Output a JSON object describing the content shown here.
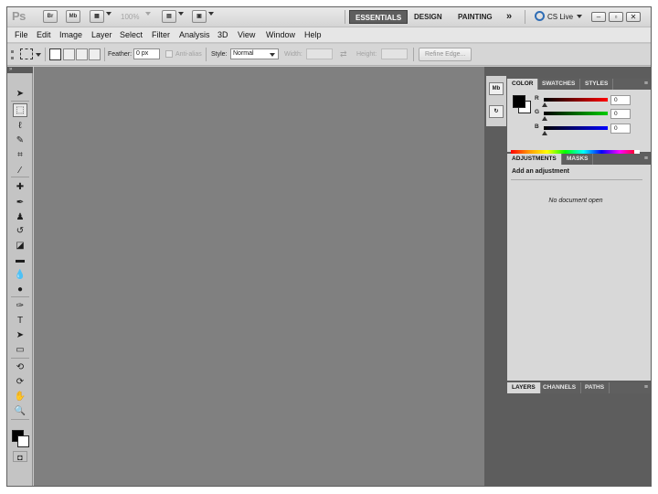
{
  "app": {
    "logo": "Ps",
    "bridge_icon": "Br",
    "minibridge_icon": "Mb",
    "zoom": "100%",
    "workspaces": [
      "ESSENTIALS",
      "DESIGN",
      "PAINTING"
    ],
    "overflow": "»",
    "cs_live": "CS Live",
    "window_controls": {
      "minimize": "–",
      "restore": "▫",
      "close": "✕"
    }
  },
  "menu": [
    "File",
    "Edit",
    "Image",
    "Layer",
    "Select",
    "Filter",
    "Analysis",
    "3D",
    "View",
    "Window",
    "Help"
  ],
  "options": {
    "feather_label": "Feather:",
    "feather_value": "0 px",
    "antialias_label": "Anti-alias",
    "style_label": "Style:",
    "style_value": "Normal",
    "width_label": "Width:",
    "height_label": "Height:",
    "refine_edge": "Refine Edge..."
  },
  "toolbar": {
    "collapse": "»",
    "tools": [
      {
        "name": "move-tool-icon",
        "glyph": "➤"
      },
      {
        "name": "rectangular-marquee-tool-icon",
        "glyph": "⬚"
      },
      {
        "name": "lasso-tool-icon",
        "glyph": "ℓ"
      },
      {
        "name": "quick-selection-tool-icon",
        "glyph": "✎"
      },
      {
        "name": "crop-tool-icon",
        "glyph": "⌗"
      },
      {
        "name": "eyedropper-tool-icon",
        "glyph": "⁄"
      },
      {
        "name": "spot-healing-brush-tool-icon",
        "glyph": "✚"
      },
      {
        "name": "brush-tool-icon",
        "glyph": "✒"
      },
      {
        "name": "clone-stamp-tool-icon",
        "glyph": "♟"
      },
      {
        "name": "history-brush-tool-icon",
        "glyph": "↺"
      },
      {
        "name": "eraser-tool-icon",
        "glyph": "◪"
      },
      {
        "name": "gradient-tool-icon",
        "glyph": "▬"
      },
      {
        "name": "blur-tool-icon",
        "glyph": "💧"
      },
      {
        "name": "dodge-tool-icon",
        "glyph": "●"
      },
      {
        "name": "pen-tool-icon",
        "glyph": "✑"
      },
      {
        "name": "type-tool-icon",
        "glyph": "T"
      },
      {
        "name": "path-selection-tool-icon",
        "glyph": "➤"
      },
      {
        "name": "shape-tool-icon",
        "glyph": "▭"
      },
      {
        "name": "3d-rotate-tool-icon",
        "glyph": "⟲"
      },
      {
        "name": "3d-orbit-tool-icon",
        "glyph": "⟳"
      },
      {
        "name": "hand-tool-icon",
        "glyph": "✋"
      },
      {
        "name": "zoom-tool-icon",
        "glyph": "🔍"
      }
    ],
    "quick_mask": "◘"
  },
  "panels": {
    "color_tabs": [
      "COLOR",
      "SWATCHES",
      "STYLES"
    ],
    "channels": [
      {
        "label": "R",
        "value": "0",
        "gradient": [
          "#000000",
          "#ff0000"
        ]
      },
      {
        "label": "G",
        "value": "0",
        "gradient": [
          "#000000",
          "#00cc00"
        ]
      },
      {
        "label": "B",
        "value": "0",
        "gradient": [
          "#000000",
          "#0000ff"
        ]
      }
    ],
    "foreground_color": "#000000",
    "background_color": "#ffffff",
    "adjust_tabs": [
      "ADJUSTMENTS",
      "MASKS"
    ],
    "adjust_title": "Add an adjustment",
    "adjust_message": "No document open",
    "layer_tabs": [
      "LAYERS",
      "CHANNELS",
      "PATHS"
    ]
  }
}
